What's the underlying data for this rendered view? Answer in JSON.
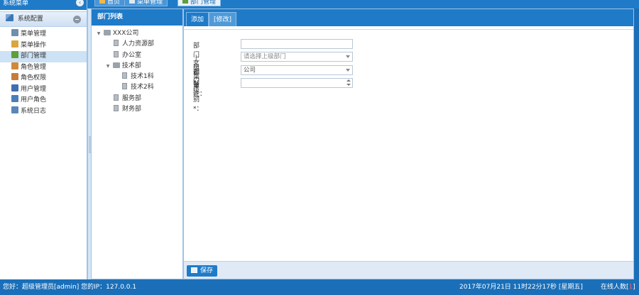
{
  "left": {
    "title": "系统菜单",
    "group": "系统配置",
    "items": [
      {
        "label": "菜单管理",
        "icon": "menu-manage-icon",
        "color": "#6f8fb0"
      },
      {
        "label": "菜单操作",
        "icon": "menu-action-icon",
        "color": "#d9a640"
      },
      {
        "label": "部门管理",
        "icon": "dept-icon",
        "color": "#5f9e3c"
      },
      {
        "label": "角色管理",
        "icon": "role-icon",
        "color": "#d08a3a"
      },
      {
        "label": "角色权限",
        "icon": "role-permission-icon",
        "color": "#c77c3a"
      },
      {
        "label": "用户管理",
        "icon": "user-icon",
        "color": "#3f6fb1"
      },
      {
        "label": "用户角色",
        "icon": "user-role-icon",
        "color": "#4a7fb8"
      },
      {
        "label": "系统日志",
        "icon": "log-icon",
        "color": "#5a86b8"
      }
    ]
  },
  "tabs": [
    {
      "label": "首页",
      "icon": "home-icon"
    },
    {
      "label": "菜单管理",
      "icon": "menu-manage-icon"
    },
    {
      "label": "部门管理",
      "icon": "dept-icon"
    }
  ],
  "tree": {
    "title": "部门列表",
    "nodes": [
      {
        "label": "XXX公司",
        "level": 0,
        "type": "folder",
        "expanded": true
      },
      {
        "label": "人力资源部",
        "level": 1,
        "type": "leaf"
      },
      {
        "label": "办公室",
        "level": 1,
        "type": "leaf"
      },
      {
        "label": "技术部",
        "level": 1,
        "type": "folder",
        "expanded": true
      },
      {
        "label": "技术1科",
        "level": 2,
        "type": "leaf"
      },
      {
        "label": "技术2科",
        "level": 2,
        "type": "leaf"
      },
      {
        "label": "服务部",
        "level": 1,
        "type": "leaf"
      },
      {
        "label": "财务部",
        "level": 1,
        "type": "leaf"
      }
    ]
  },
  "edit": {
    "tabs": [
      "添加",
      "[修改]"
    ],
    "form": {
      "dept_name_label": "部门名称*：",
      "dept_name_value": "",
      "parent_label": "上级菜单*：",
      "parent_placeholder": "请选择上级部门",
      "level_label": "部门级别*：",
      "level_value": "公司",
      "remark_label": "备注："
    },
    "save_label": "保存"
  },
  "status": {
    "greeting": "您好：超级管理员[admin] 您的IP：127.0.0.1",
    "datetime": "2017年07月21日 11时22分17秒 [星期五]",
    "online_label": "在线人数[",
    "online_count": "1",
    "online_suffix": "]"
  },
  "colors": {
    "accent": "#1f7bc8",
    "active_menu": "#cde2f5"
  }
}
